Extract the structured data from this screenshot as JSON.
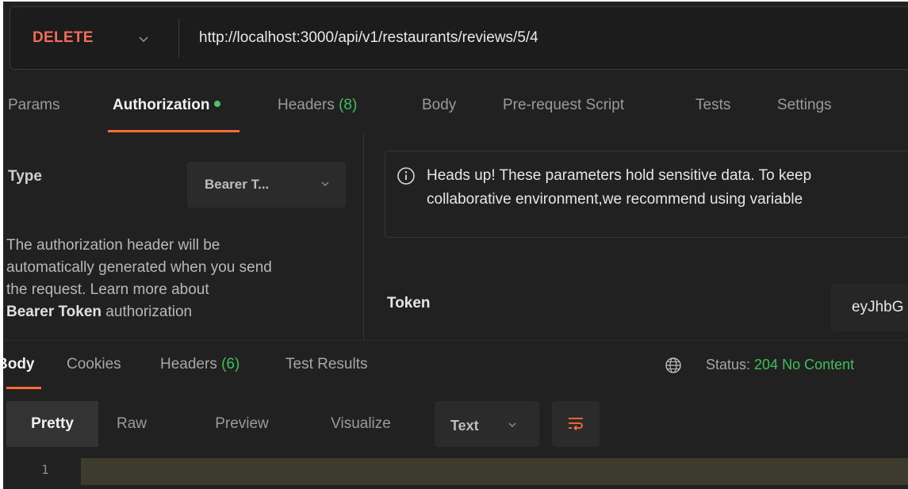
{
  "url_bar": {
    "method": "DELETE",
    "url": "http://localhost:3000/api/v1/restaurants/reviews/5/4"
  },
  "request_tabs": [
    {
      "label": "Params"
    },
    {
      "label": "Authorization"
    },
    {
      "label": "Headers",
      "count": "(8)"
    },
    {
      "label": "Body"
    },
    {
      "label": "Pre-request Script"
    },
    {
      "label": "Tests"
    },
    {
      "label": "Settings"
    }
  ],
  "auth": {
    "type_label": "Type",
    "type_value": "Bearer T...",
    "desc_line1": "The authorization header will be",
    "desc_line2": "automatically generated when you send",
    "desc_line3": "the request. Learn more about",
    "desc_link": "Bearer Token",
    "desc_tail": " authorization",
    "notice_line1": "Heads up! These parameters hold sensitive data. To keep",
    "notice_line2": "collaborative environment,we recommend using variable",
    "token_label": "Token",
    "token_value": "eyJhbG"
  },
  "response_tabs": [
    {
      "label": "Body"
    },
    {
      "label": "Cookies"
    },
    {
      "label": "Headers",
      "count": "(6)"
    },
    {
      "label": "Test Results"
    }
  ],
  "status": {
    "label": "Status:",
    "value": "204 No Content"
  },
  "view_buttons": [
    {
      "label": "Pretty"
    },
    {
      "label": "Raw"
    },
    {
      "label": "Preview"
    },
    {
      "label": "Visualize"
    }
  ],
  "format_select": "Text",
  "editor": {
    "line_number": "1"
  },
  "colors": {
    "accent": "#ff6c37",
    "method": "#f26b5b",
    "success": "#3fbf5b",
    "background": "#212121"
  }
}
